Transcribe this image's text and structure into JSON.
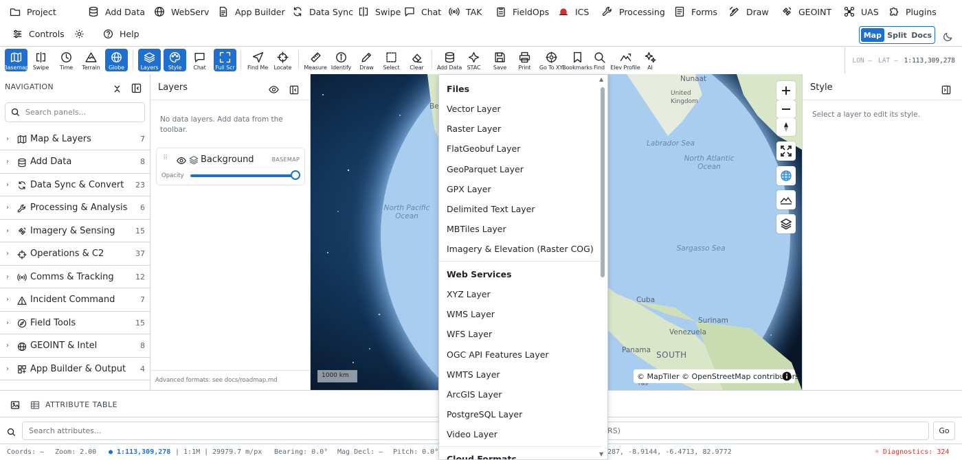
{
  "menu": [
    {
      "label": "Project",
      "icon": "folder-icon"
    },
    {
      "label": "Add Data",
      "icon": "database-icon"
    },
    {
      "label": "WebServ",
      "icon": "globe-icon"
    },
    {
      "label": "App Builder",
      "icon": "document-icon"
    },
    {
      "label": "Data Sync",
      "icon": "sync-icon"
    },
    {
      "label": "Swipe",
      "icon": "swipe-icon"
    },
    {
      "label": "Chat",
      "icon": "chat-icon"
    },
    {
      "label": "TAK",
      "icon": "broadcast-icon"
    },
    {
      "label": "FieldOps",
      "icon": "clipboard-icon"
    },
    {
      "label": "ICS",
      "icon": "siren-icon"
    },
    {
      "label": "Processing",
      "icon": "wrench-icon"
    },
    {
      "label": "Forms",
      "icon": "form-icon"
    },
    {
      "label": "Draw",
      "icon": "draw-icon"
    },
    {
      "label": "GEOINT",
      "icon": "satellite-icon"
    },
    {
      "label": "UAS",
      "icon": "drone-icon"
    },
    {
      "label": "Plugins",
      "icon": "puzzle-icon"
    }
  ],
  "row2": {
    "controls": "Controls",
    "help": "Help"
  },
  "view_modes": {
    "map": "Map",
    "split": "Split",
    "docs": "Docs",
    "active": "Map"
  },
  "toolbar": [
    {
      "label": "Basemap",
      "icon": "basemap-icon",
      "active": true
    },
    {
      "label": "Swipe",
      "icon": "swipe-icon",
      "active": false
    },
    {
      "label": "Time",
      "icon": "clock-icon",
      "active": false
    },
    {
      "label": "Terrain",
      "icon": "terrain-icon",
      "active": false
    },
    {
      "label": "Globe",
      "icon": "globe-icon",
      "active": true
    },
    {
      "label": "Layers",
      "icon": "layers-icon",
      "active": true
    },
    {
      "label": "Style",
      "icon": "palette-icon",
      "active": true
    },
    {
      "label": "Chat",
      "icon": "chat-icon",
      "active": false
    },
    {
      "label": "Full Scr",
      "icon": "fullscreen-icon",
      "active": true
    },
    {
      "label": "Find Me",
      "icon": "location-arrow-icon",
      "active": false
    },
    {
      "label": "Locate",
      "icon": "crosshair-icon",
      "active": false
    },
    {
      "label": "Measure",
      "icon": "ruler-icon",
      "active": false
    },
    {
      "label": "Identify",
      "icon": "info-icon",
      "active": false
    },
    {
      "label": "Draw",
      "icon": "pencil-icon",
      "active": false
    },
    {
      "label": "Select",
      "icon": "select-box-icon",
      "active": false
    },
    {
      "label": "Clear",
      "icon": "eraser-icon",
      "active": false
    },
    {
      "label": "Add Data",
      "icon": "database-icon",
      "active": false
    },
    {
      "label": "STAC",
      "icon": "stac-icon",
      "active": false
    },
    {
      "label": "Save",
      "icon": "save-icon",
      "active": false
    },
    {
      "label": "Print",
      "icon": "printer-icon",
      "active": false
    },
    {
      "label": "Go To XY",
      "icon": "target-icon",
      "active": false
    },
    {
      "label": "Bookmarks",
      "icon": "bookmark-icon",
      "active": false
    },
    {
      "label": "Find",
      "icon": "search-icon",
      "active": false
    },
    {
      "label": "Elev Profile",
      "icon": "profile-icon",
      "active": false
    },
    {
      "label": "AI",
      "icon": "sparkle-icon",
      "active": false
    }
  ],
  "coords": {
    "lon": "LON —",
    "lat": "LAT —",
    "scale": "1:113,309,278"
  },
  "navigation": {
    "title": "NAVIGATION",
    "search_placeholder": "Search panels...",
    "items": [
      {
        "label": "Map & Layers",
        "count": "7",
        "icon": "map-icon"
      },
      {
        "label": "Add Data",
        "count": "8",
        "icon": "database-icon"
      },
      {
        "label": "Data Sync & Convert",
        "count": "23",
        "icon": "sync-icon"
      },
      {
        "label": "Processing & Analysis",
        "count": "6",
        "icon": "wrench-icon"
      },
      {
        "label": "Imagery & Sensing",
        "count": "15",
        "icon": "satellite-icon"
      },
      {
        "label": "Operations & C2",
        "count": "37",
        "icon": "crosshair-icon"
      },
      {
        "label": "Comms & Tracking",
        "count": "12",
        "icon": "broadcast-icon"
      },
      {
        "label": "Incident Command",
        "count": "7",
        "icon": "warning-icon"
      },
      {
        "label": "Field Tools",
        "count": "15",
        "icon": "compass-icon"
      },
      {
        "label": "GEOINT & Intel",
        "count": "8",
        "icon": "globe-icon"
      },
      {
        "label": "App Builder & Output",
        "count": "4",
        "icon": "grid-icon"
      }
    ]
  },
  "layers_panel": {
    "title": "Layers",
    "empty": "No data layers. Add data from the toolbar.",
    "background": {
      "name": "Background",
      "badge": "BASEMAP",
      "opacity_label": "Opacity",
      "opacity": 1.0
    },
    "footer": "Advanced formats: see docs/roadmap.md"
  },
  "map": {
    "labels": {
      "north_pacific": "North Pacific\nOcean",
      "north_atlantic": "North Atlantic\nOcean",
      "sargasso": "Sargasso Sea",
      "labrador": "Labrador Sea",
      "cuba": "Cuba",
      "venezuela": "Venezuela",
      "panama": "Panama",
      "south": "SOUTH",
      "surinam": "Surinam",
      "united": "United",
      "kingdom": "Kingdom",
      "nunaat": "Nunaat"
    },
    "scale_bar": "1000 km",
    "attribution": "© MapTiler © OpenStreetMap contributors"
  },
  "add_data_menu": {
    "files_title": "Files",
    "files": [
      "Vector Layer",
      "Raster Layer",
      "FlatGeobuf Layer",
      "GeoParquet Layer",
      "GPX Layer",
      "Delimited Text Layer",
      "MBTiles Layer",
      "Imagery & Elevation (Raster COG)"
    ],
    "web_title": "Web Services",
    "web": [
      "XYZ Layer",
      "WMS Layer",
      "WFS Layer",
      "OGC API Features Layer",
      "WMTS Layer",
      "ArcGIS Layer",
      "PostgreSQL Layer",
      "Video Layer"
    ],
    "cloud_title": "Cloud Formats"
  },
  "style_panel": {
    "title": "Style",
    "hint": "Select a layer to edit its style."
  },
  "attribute_table": {
    "title": "ATTRIBUTE TABLE",
    "search_placeholder": "Search attributes...",
    "crs_suffix": "RS)",
    "go": "Go"
  },
  "status": {
    "coords": "Coords: —",
    "zoom": "Zoom: 2.00",
    "scale": "● 1:113,309,278",
    "ratio": "| 1:1M |",
    "mpx": "29979.7 m/px",
    "bearing": "Bearing: 0.0°",
    "magdecl": "Mag Decl: —",
    "pitch": "Pitch: 0.0°",
    "extent": "287, -8.9144, -6.4713, 82.9772",
    "diagnostics": "Diagnostics: 324"
  }
}
